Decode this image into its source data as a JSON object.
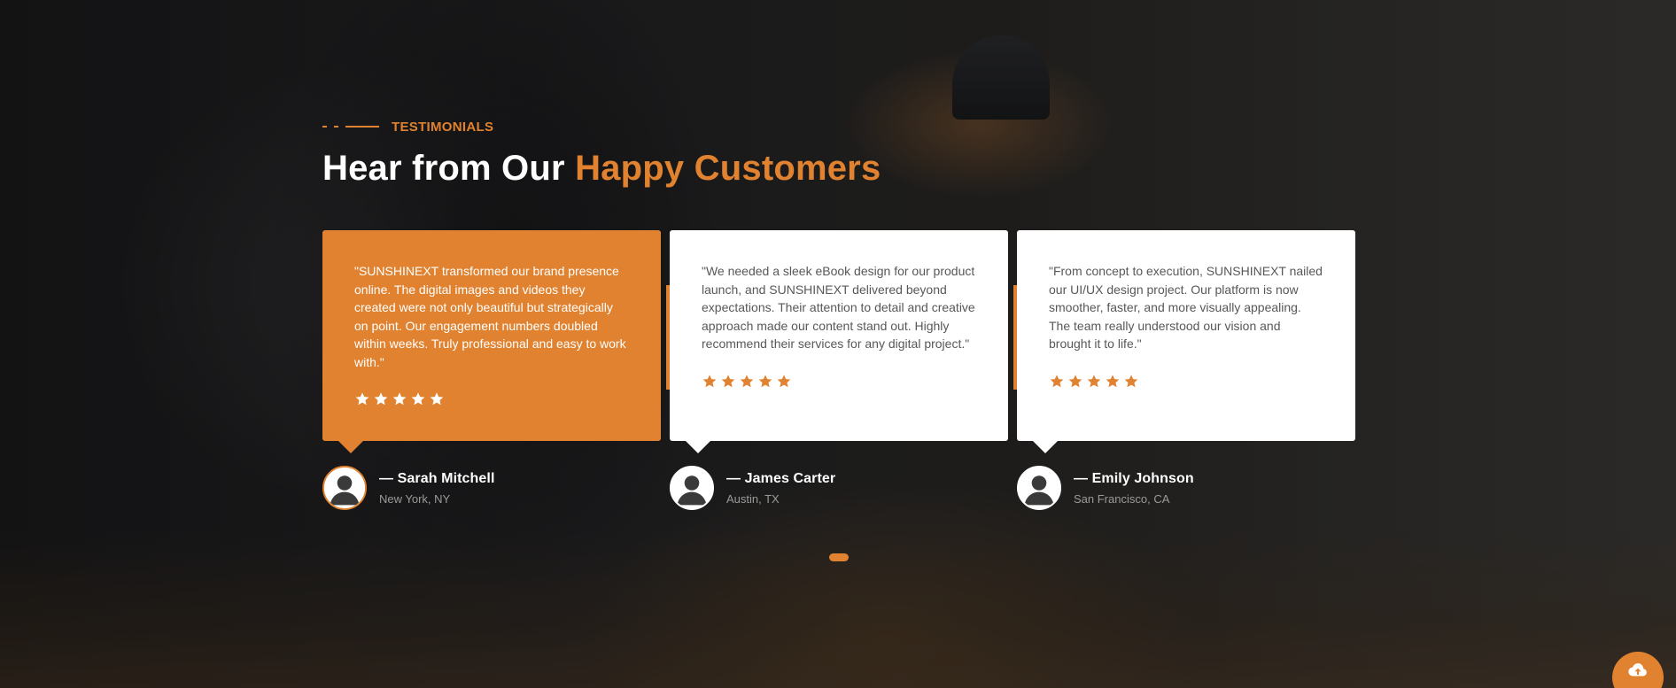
{
  "colors": {
    "accent": "#e0822f",
    "card_bg": "#ffffff",
    "text_dark": "#585858"
  },
  "section": {
    "eyebrow": "TESTIMONIALS",
    "title_main": "Hear from Our ",
    "title_accent": "Happy Customers"
  },
  "testimonials": [
    {
      "quote": "\"SUNSHINEXT transformed our brand presence online. The digital images and videos they created were not only beautiful but strategically on point. Our engagement numbers doubled within weeks. Truly professional and easy to work with.\"",
      "rating": 5,
      "name": "— Sarah Mitchell",
      "location": "New York, NY",
      "active": true
    },
    {
      "quote": "\"We needed a sleek eBook design for our product launch, and SUNSHINEXT delivered beyond expectations. Their attention to detail and creative approach made our content stand out. Highly recommend their services for any digital project.\"",
      "rating": 5,
      "name": "— James Carter",
      "location": "Austin, TX",
      "active": false
    },
    {
      "quote": "\"From concept to execution, SUNSHINEXT nailed our UI/UX design project. Our platform is now smoother, faster, and more visually appealing. The team really understood our vision and brought it to life.\"",
      "rating": 5,
      "name": "— Emily Johnson",
      "location": "San Francisco, CA",
      "active": false
    }
  ],
  "carousel": {
    "active_page": 1,
    "page_count": 1
  },
  "icons": {
    "upload": "cloud-upload-icon",
    "star": "star-icon",
    "avatar": "user-avatar-icon"
  }
}
